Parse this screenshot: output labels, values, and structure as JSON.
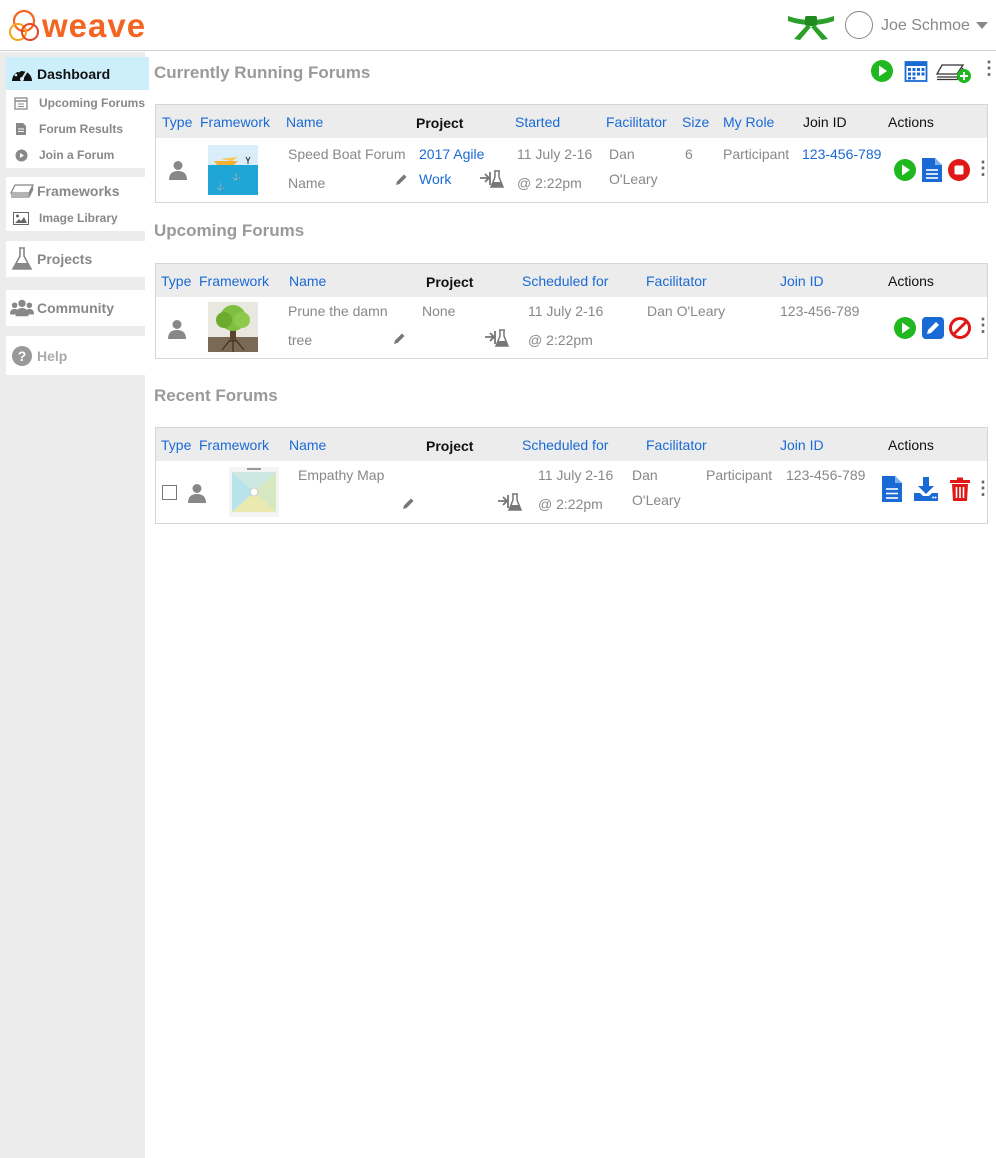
{
  "app": {
    "logo_text": "weave"
  },
  "user": {
    "name": "Joe Schmoe"
  },
  "sidebar": {
    "dashboard": "Dashboard",
    "upcoming": "Upcoming Forums",
    "results": "Forum Results",
    "join": "Join a Forum",
    "frameworks": "Frameworks",
    "images": "Image Library",
    "projects": "Projects",
    "community": "Community",
    "help": "Help"
  },
  "running": {
    "title": "Currently Running Forums",
    "headers": {
      "type": "Type",
      "framework": "Framework",
      "name": "Name",
      "project": "Project",
      "started": "Started",
      "facilitator": "Facilitator",
      "size": "Size",
      "role": "My Role",
      "join": "Join ID",
      "actions": "Actions"
    },
    "row": {
      "name_line1": "Speed Boat Forum",
      "name_line2": "Name",
      "project_line1": "2017 Agile",
      "project_line2": "Work",
      "started_line1": "11 July 2-16",
      "started_line2": "@ 2:22pm",
      "facilitator_line1": "Dan",
      "facilitator_line2": "O'Leary",
      "size": "6",
      "role": "Participant",
      "join_id": "123-456-789"
    }
  },
  "upcoming": {
    "title": "Upcoming Forums",
    "headers": {
      "type": "Type",
      "framework": "Framework",
      "name": "Name",
      "project": "Project",
      "scheduled": "Scheduled for",
      "facilitator": "Facilitator",
      "join": "Join ID",
      "actions": "Actions"
    },
    "row": {
      "name_line1": "Prune the damn",
      "name_line2": "tree",
      "project": "None",
      "scheduled_line1": "11 July 2-16",
      "scheduled_line2": "@ 2:22pm",
      "facilitator": "Dan O'Leary",
      "join_id": "123-456-789"
    }
  },
  "recent": {
    "title": "Recent Forums",
    "headers": {
      "type": "Type",
      "framework": "Framework",
      "name": "Name",
      "project": "Project",
      "scheduled": "Scheduled for",
      "facilitator": "Facilitator",
      "join": "Join ID",
      "actions": "Actions"
    },
    "row": {
      "name": "Empathy Map",
      "scheduled_line1": "11 July 2-16",
      "scheduled_line2": "@ 2:22pm",
      "facilitator_line1": "Dan",
      "facilitator_line2": "O'Leary",
      "role": "Participant",
      "join_id": "123-456-789"
    }
  },
  "colors": {
    "brand": "#f26522",
    "link": "#1a6ad6",
    "go": "#1fb81f",
    "stop": "#e01818",
    "active_nav": "#cdeefb"
  }
}
